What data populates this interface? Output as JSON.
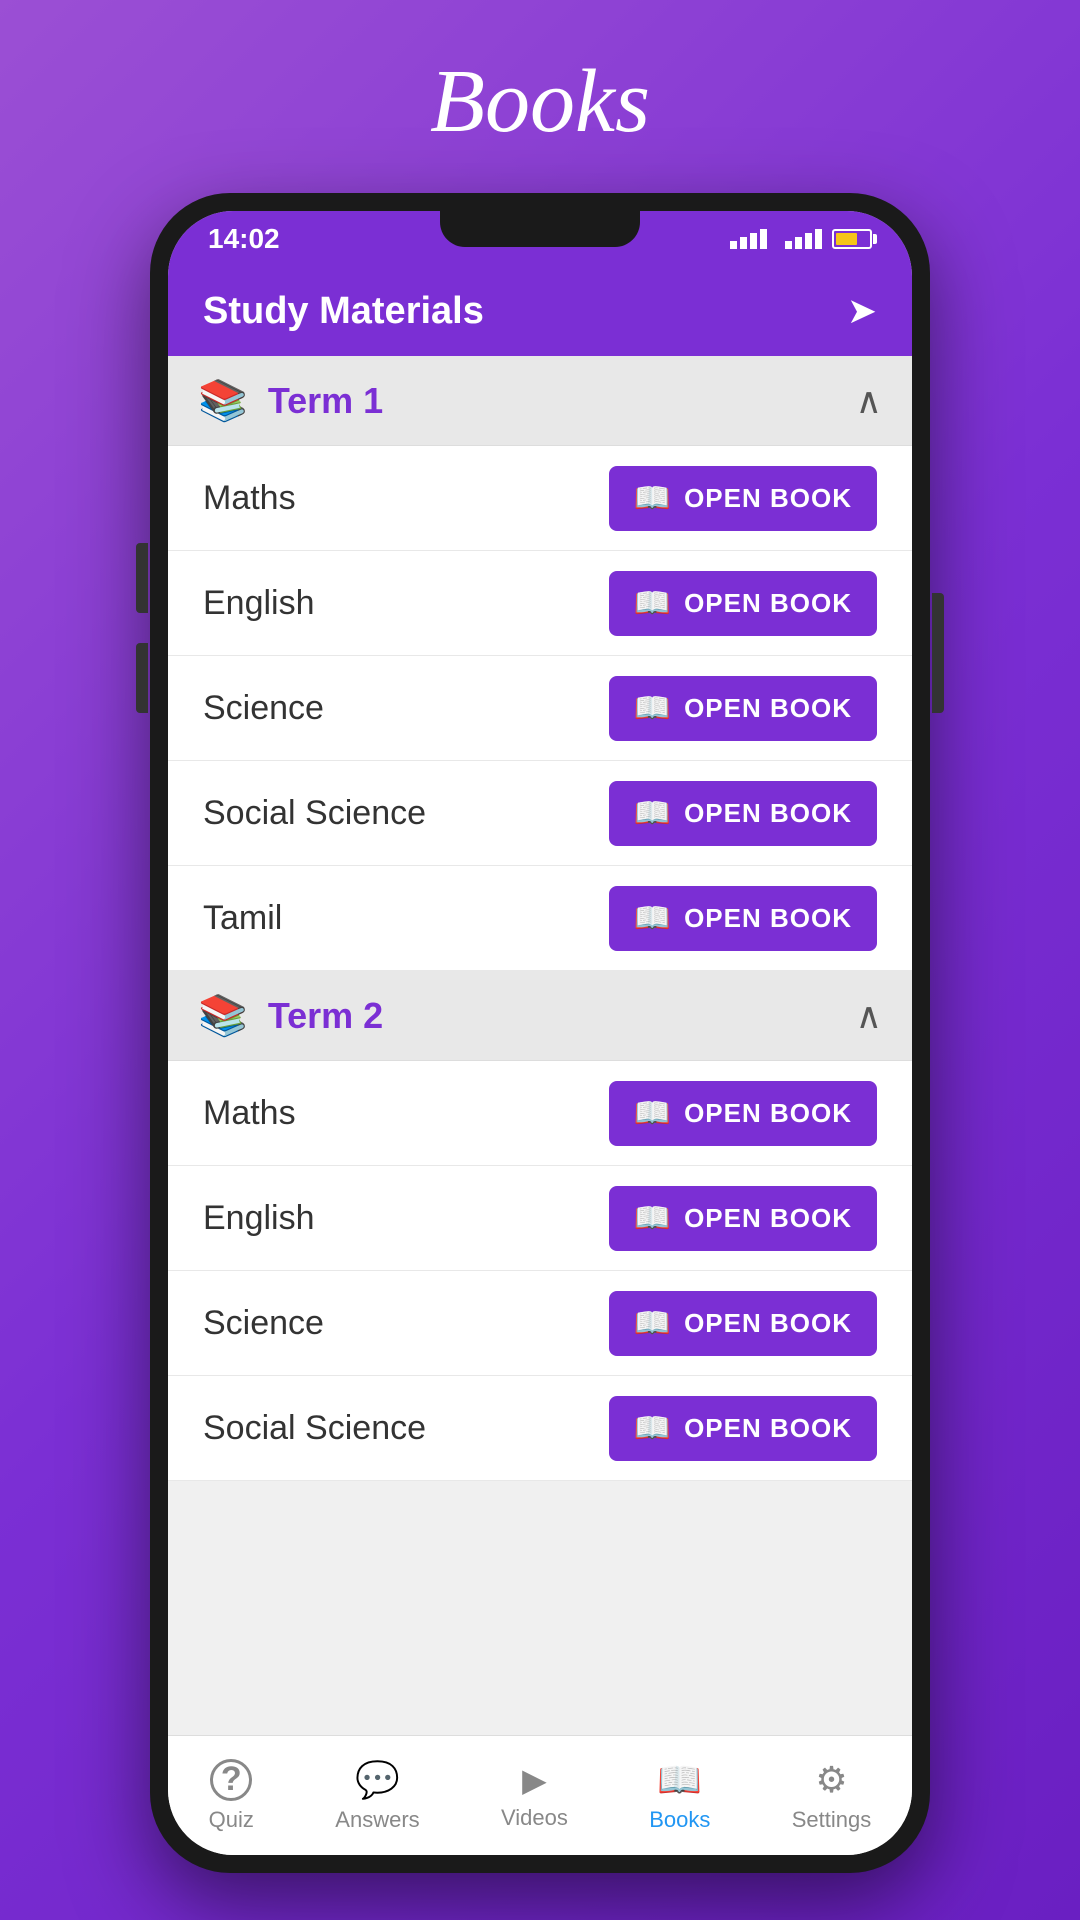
{
  "page": {
    "title": "Books",
    "background_color": "#8B3DD4"
  },
  "header": {
    "title": "Study Materials",
    "share_icon": "◄"
  },
  "status_bar": {
    "time": "14:02"
  },
  "terms": [
    {
      "id": "term1",
      "label": "Term 1",
      "expanded": true,
      "subjects": [
        {
          "name": "Maths",
          "button_label": "OPEN BOOK"
        },
        {
          "name": "English",
          "button_label": "OPEN BOOK"
        },
        {
          "name": "Science",
          "button_label": "OPEN BOOK"
        },
        {
          "name": "Social Science",
          "button_label": "OPEN BOOK"
        },
        {
          "name": "Tamil",
          "button_label": "OPEN BOOK"
        }
      ]
    },
    {
      "id": "term2",
      "label": "Term 2",
      "expanded": true,
      "subjects": [
        {
          "name": "Maths",
          "button_label": "OPEN BOOK"
        },
        {
          "name": "English",
          "button_label": "OPEN BOOK"
        },
        {
          "name": "Science",
          "button_label": "OPEN BOOK"
        },
        {
          "name": "Social Science",
          "button_label": "OPEN BOOK"
        }
      ]
    }
  ],
  "bottom_nav": [
    {
      "id": "quiz",
      "label": "Quiz",
      "icon": "?",
      "active": false
    },
    {
      "id": "answers",
      "label": "Answers",
      "icon": "💬",
      "active": false
    },
    {
      "id": "videos",
      "label": "Videos",
      "icon": "▶",
      "active": false
    },
    {
      "id": "books",
      "label": "Books",
      "icon": "📖",
      "active": true
    },
    {
      "id": "settings",
      "label": "Settings",
      "icon": "⚙",
      "active": false
    }
  ]
}
